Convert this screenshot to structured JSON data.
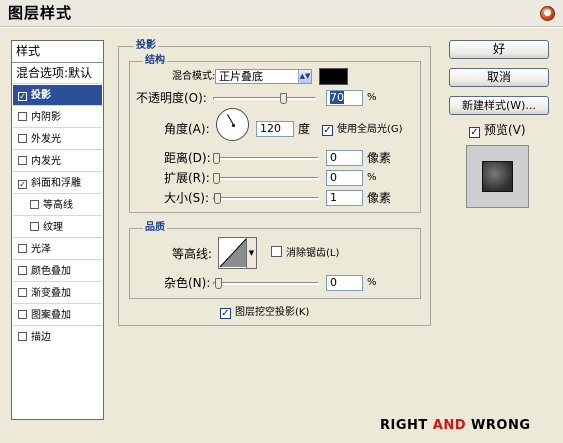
{
  "window": {
    "title": "图层样式",
    "close_glyph": "●"
  },
  "sidebar": {
    "header": "样式",
    "items": [
      {
        "label": "混合选项:默认",
        "checkbox": false,
        "checked": false,
        "selected": false,
        "indent": false
      },
      {
        "label": "投影",
        "checkbox": true,
        "checked": true,
        "selected": true,
        "indent": false
      },
      {
        "label": "内阴影",
        "checkbox": true,
        "checked": false,
        "selected": false,
        "indent": false
      },
      {
        "label": "外发光",
        "checkbox": true,
        "checked": false,
        "selected": false,
        "indent": false
      },
      {
        "label": "内发光",
        "checkbox": true,
        "checked": false,
        "selected": false,
        "indent": false
      },
      {
        "label": "斜面和浮雕",
        "checkbox": true,
        "checked": true,
        "selected": false,
        "indent": false
      },
      {
        "label": "等高线",
        "checkbox": true,
        "checked": false,
        "selected": false,
        "indent": true
      },
      {
        "label": "纹理",
        "checkbox": true,
        "checked": false,
        "selected": false,
        "indent": true
      },
      {
        "label": "光泽",
        "checkbox": true,
        "checked": false,
        "selected": false,
        "indent": false
      },
      {
        "label": "颜色叠加",
        "checkbox": true,
        "checked": false,
        "selected": false,
        "indent": false
      },
      {
        "label": "渐变叠加",
        "checkbox": true,
        "checked": false,
        "selected": false,
        "indent": false
      },
      {
        "label": "图案叠加",
        "checkbox": true,
        "checked": false,
        "selected": false,
        "indent": false
      },
      {
        "label": "描边",
        "checkbox": true,
        "checked": false,
        "selected": false,
        "indent": false
      }
    ]
  },
  "panel": {
    "group_title": "投影",
    "structure": {
      "legend": "结构",
      "blend_mode_label": "混合模式:",
      "blend_mode_value": "正片叠底",
      "shadow_color": "#000000",
      "opacity_label": "不透明度(O):",
      "opacity_value": "70",
      "opacity_unit": "%",
      "opacity_fraction": 0.7,
      "angle_label": "角度(A):",
      "angle_value": "120",
      "angle_unit": "度",
      "global_light_label": "使用全局光(G)",
      "global_light_checked": true,
      "distance_label": "距离(D):",
      "distance_value": "0",
      "distance_unit": "像素",
      "spread_label": "扩展(R):",
      "spread_value": "0",
      "spread_unit": "%",
      "size_label": "大小(S):",
      "size_value": "1",
      "size_unit": "像素"
    },
    "quality": {
      "legend": "品质",
      "contour_label": "等高线:",
      "antialias_label": "消除锯齿(L)",
      "antialias_checked": false,
      "noise_label": "杂色(N):",
      "noise_value": "0",
      "noise_unit": "%"
    },
    "knockout_label": "图层挖空投影(K)",
    "knockout_checked": true
  },
  "buttons": {
    "ok": "好",
    "cancel": "取消",
    "new_style": "新建样式(W)...",
    "preview_label": "预览(V)",
    "preview_checked": true
  },
  "watermark": {
    "part1": "RIGHT ",
    "part2": "AND",
    "part3": " WRONG"
  },
  "icons": {
    "close": "close-icon",
    "select_arrow": "up-down-arrow-icon",
    "contour_arrow": "chevron-down-icon",
    "angle": "angle-dial-icon",
    "checkmark": "check-icon"
  }
}
